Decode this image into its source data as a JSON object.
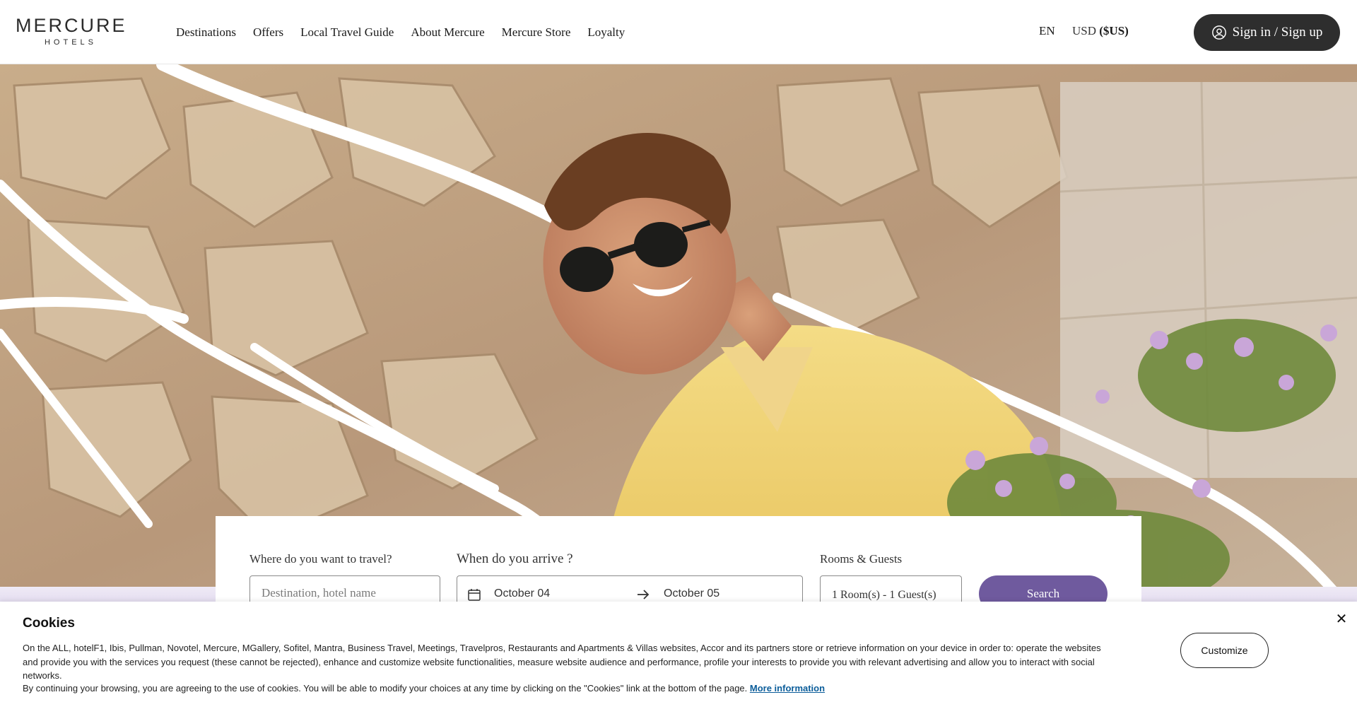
{
  "header": {
    "logo_main": "MERCURE",
    "logo_sub": "HOTELS",
    "nav": [
      "Destinations",
      "Offers",
      "Local Travel Guide",
      "About Mercure",
      "Mercure Store",
      "Loyalty"
    ],
    "language": "EN",
    "currency_code": "USD",
    "currency_symbol": "($US)",
    "signin_label": "Sign in / Sign up",
    "signin_icon": "user-circle-icon"
  },
  "search": {
    "destination_label": "Where do you want to travel?",
    "destination_placeholder": "Destination, hotel name",
    "arrival_label": "When do you arrive ?",
    "date_start": "October 04",
    "date_end": "October 05",
    "rooms_label": "Rooms & Guests",
    "rooms_value": "1 Room(s) - 1 Guest(s)",
    "search_button": "Search"
  },
  "cookie": {
    "title": "Cookies",
    "text": "On the ALL, hotelF1, Ibis, Pullman, Novotel, Mercure, MGallery, Sofitel, Mantra, Business Travel, Meetings, Travelpros, Restaurants and Apartments & Villas websites, Accor and its partners store or retrieve information on your device in order to: operate the websites and provide you with the services you request (these cannot be rejected), enhance and customize website functionalities, measure website audience and performance, profile your interests to provide you with relevant advertising and allow you to interact with social networks.",
    "text2": "By continuing your browsing, you are agreeing to the use of cookies. You will be able to modify your choices at any time by clicking on the \"Cookies\" link at the bottom of the page.",
    "more_link": "More information",
    "customize_button": "Customize",
    "close_symbol": "✕"
  },
  "colors": {
    "brand_dark": "#2e2e2e",
    "search_purple": "#6f5a9e",
    "link_blue": "#0b5d9a"
  }
}
